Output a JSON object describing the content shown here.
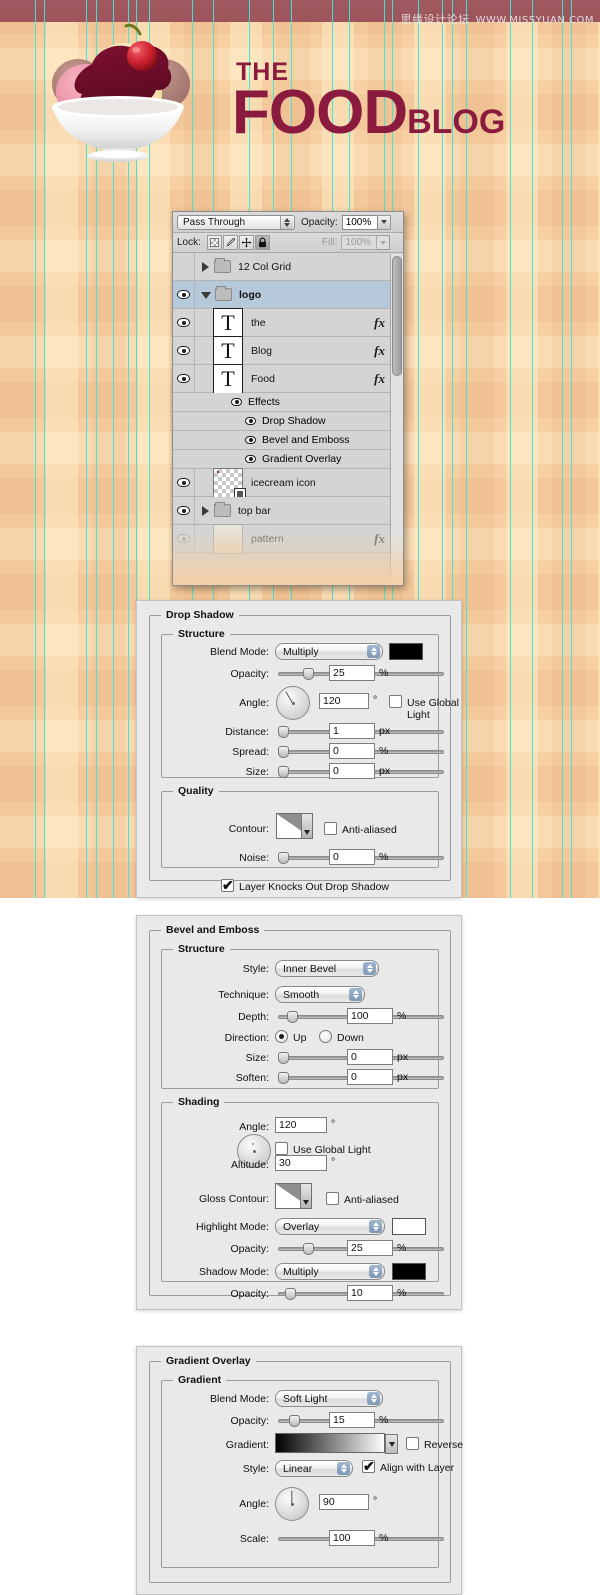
{
  "watermark": {
    "cn": "思缘设计论坛",
    "url": "WWW.MISSYUAN.COM"
  },
  "logo": {
    "the": "THE",
    "food": "FOOD",
    "blog": "BLOG",
    "color": "#8a1b3e"
  },
  "guides": [
    35,
    44,
    86,
    96,
    113,
    128,
    136,
    149,
    192,
    213,
    249,
    273,
    291,
    332,
    349,
    384,
    392,
    418,
    442,
    452,
    466,
    510,
    532,
    562,
    571
  ],
  "layers_panel": {
    "blend_mode": "Pass Through",
    "opacity_label": "Opacity:",
    "opacity_value": "100%",
    "lock_label": "Lock:",
    "fill_label": "Fill:",
    "fill_value": "100%",
    "lock_buttons": [
      "lock-transparent-pixels",
      "lock-image-pixels",
      "lock-position",
      "lock-all"
    ],
    "rows": [
      {
        "type": "group",
        "name": "12 Col Grid",
        "visible": false,
        "expanded": false,
        "selected": false,
        "fx": false
      },
      {
        "type": "group",
        "name": "logo",
        "visible": true,
        "expanded": true,
        "selected": true,
        "fx": false
      },
      {
        "type": "text",
        "name": "the",
        "visible": true,
        "thumb": "T",
        "fx": true,
        "fx_arrow": "down"
      },
      {
        "type": "text",
        "name": "Blog",
        "visible": true,
        "thumb": "T",
        "fx": true,
        "fx_arrow": "down"
      },
      {
        "type": "text",
        "name": "Food",
        "visible": true,
        "thumb": "T",
        "fx": true,
        "fx_arrow": "up"
      },
      {
        "type": "effects-header",
        "name": "Effects",
        "visible": true
      },
      {
        "type": "effect",
        "name": "Drop Shadow",
        "visible": true
      },
      {
        "type": "effect",
        "name": "Bevel and Emboss",
        "visible": true
      },
      {
        "type": "effect",
        "name": "Gradient Overlay",
        "visible": true
      },
      {
        "type": "raster",
        "name": "icecream icon",
        "visible": true
      },
      {
        "type": "group",
        "name": "top bar",
        "visible": true,
        "expanded": false
      },
      {
        "type": "raster",
        "name": "pattern",
        "visible": true,
        "faded": true,
        "fx": true
      }
    ]
  },
  "drop_shadow": {
    "title": "Drop Shadow",
    "structure_title": "Structure",
    "quality_title": "Quality",
    "blend_mode_label": "Blend Mode:",
    "blend_mode_value": "Multiply",
    "blend_color": "#000000",
    "opacity_label": "Opacity:",
    "opacity_value": "25",
    "opacity_unit": "%",
    "angle_label": "Angle:",
    "angle_value": "120",
    "angle_unit": "°",
    "use_global_light_label": "Use Global Light",
    "use_global_light_checked": false,
    "distance_label": "Distance:",
    "distance_value": "1",
    "distance_unit": "px",
    "spread_label": "Spread:",
    "spread_value": "0",
    "spread_unit": "%",
    "size_label": "Size:",
    "size_value": "0",
    "size_unit": "px",
    "contour_label": "Contour:",
    "anti_aliased_label": "Anti-aliased",
    "anti_aliased_checked": false,
    "noise_label": "Noise:",
    "noise_value": "0",
    "noise_unit": "%",
    "knockout_label": "Layer Knocks Out Drop Shadow",
    "knockout_checked": true
  },
  "bevel_emboss": {
    "title": "Bevel and Emboss",
    "structure_title": "Structure",
    "shading_title": "Shading",
    "style_label": "Style:",
    "style_value": "Inner Bevel",
    "technique_label": "Technique:",
    "technique_value": "Smooth",
    "depth_label": "Depth:",
    "depth_value": "100",
    "depth_unit": "%",
    "direction_label": "Direction:",
    "direction_up": "Up",
    "direction_down": "Down",
    "direction_selected": "Up",
    "size_label": "Size:",
    "size_value": "0",
    "size_unit": "px",
    "soften_label": "Soften:",
    "soften_value": "0",
    "soften_unit": "px",
    "angle_label": "Angle:",
    "angle_value": "120",
    "angle_unit": "°",
    "use_global_light_label": "Use Global Light",
    "use_global_light_checked": false,
    "altitude_label": "Altitude:",
    "altitude_value": "30",
    "altitude_unit": "°",
    "gloss_contour_label": "Gloss Contour:",
    "anti_aliased_label": "Anti-aliased",
    "anti_aliased_checked": false,
    "highlight_mode_label": "Highlight Mode:",
    "highlight_mode_value": "Overlay",
    "highlight_color": "#ffffff",
    "highlight_opacity_label": "Opacity:",
    "highlight_opacity_value": "25",
    "highlight_opacity_unit": "%",
    "shadow_mode_label": "Shadow Mode:",
    "shadow_mode_value": "Multiply",
    "shadow_color": "#000000",
    "shadow_opacity_label": "Opacity:",
    "shadow_opacity_value": "10",
    "shadow_opacity_unit": "%"
  },
  "gradient_overlay": {
    "title": "Gradient Overlay",
    "gradient_title": "Gradient",
    "blend_mode_label": "Blend Mode:",
    "blend_mode_value": "Soft Light",
    "opacity_label": "Opacity:",
    "opacity_value": "15",
    "opacity_unit": "%",
    "gradient_label": "Gradient:",
    "reverse_label": "Reverse",
    "reverse_checked": false,
    "style_label": "Style:",
    "style_value": "Linear",
    "align_label": "Align with Layer",
    "align_checked": true,
    "angle_label": "Angle:",
    "angle_value": "90",
    "angle_unit": "°",
    "scale_label": "Scale:",
    "scale_value": "100",
    "scale_unit": "%"
  }
}
